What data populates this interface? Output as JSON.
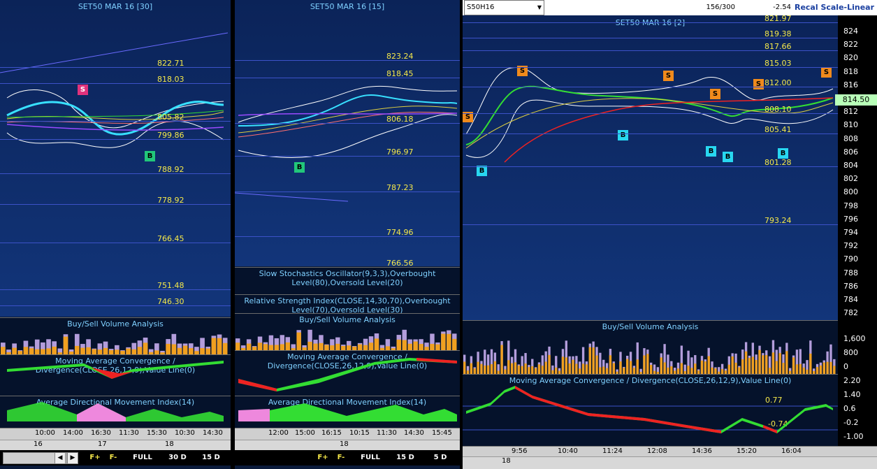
{
  "left": {
    "title": "SET50 MAR 16  [30]",
    "levels": [
      "822.71",
      "818.03",
      "805.82",
      "799.86",
      "788.92",
      "778.92",
      "766.45",
      "751.48",
      "746.30"
    ],
    "sub_vol": "Buy/Sell Volume Analysis",
    "sub_macd": "Moving Average Convergence / Divergence(CLOSE,26,12,9),Value Line(0)",
    "sub_adx": "Average Directional Movement Index(14)",
    "times": [
      "10:00",
      "14:00",
      "16:30",
      "11:30",
      "15:30",
      "10:30",
      "14:30"
    ],
    "dates": [
      "16",
      "17",
      "18"
    ],
    "signals": {
      "s": "S",
      "b": "B"
    },
    "toolbar": {
      "f_plus": "F+",
      "f_minus": "F-",
      "full": "FULL",
      "d30": "30 D",
      "d15": "15 D"
    }
  },
  "mid": {
    "title": "SET50 MAR 16  [15]",
    "levels": [
      "823.24",
      "818.45",
      "806.18",
      "796.97",
      "787.23",
      "774.96",
      "766.56"
    ],
    "sub_stoch": "Slow Stochastics Oscillator(9,3,3),Overbought Level(80),Oversold Level(20)",
    "sub_rsi": "Relative Strength Index(CLOSE,14,30,70),Overbought Level(70),Oversold Level(30)",
    "sub_vol": "Buy/Sell Volume Analysis",
    "sub_macd": "Moving Average Convergence / Divergence(CLOSE,26,12,9),Value Line(0)",
    "sub_adx": "Average Directional Movement Index(14)",
    "times": [
      "12:00",
      "15:00",
      "16:15",
      "10:15",
      "11:30",
      "14:30",
      "15:45"
    ],
    "dates": [
      "18"
    ],
    "signals": {
      "b": "B"
    },
    "toolbar": {
      "f_plus": "F+",
      "f_minus": "F-",
      "full": "FULL",
      "d15": "15 D",
      "d5": "5 D"
    }
  },
  "right": {
    "symbol": "S50H16",
    "count": "156/300",
    "change": "-2.54",
    "recal": "Recal Scale-Linear",
    "title": "SET50 MAR 16  [2]",
    "levels": [
      "821.97",
      "819.38",
      "817.66",
      "815.03",
      "812.00",
      "808.10",
      "805.41",
      "801.28",
      "793.24"
    ],
    "last_price": "814.50",
    "scale": [
      "824",
      "822",
      "820",
      "818",
      "816",
      "814",
      "812",
      "810",
      "808",
      "806",
      "804",
      "802",
      "800",
      "798",
      "796",
      "794",
      "792",
      "790",
      "788",
      "786",
      "784",
      "782"
    ],
    "vol_scale": [
      "1,600",
      "800",
      "0"
    ],
    "macd_scale": [
      "2.20",
      "1.40",
      "0.6",
      "-0.2",
      "-1.00"
    ],
    "macd_vals": [
      "0.77",
      "-0.74"
    ],
    "sub_vol": "Buy/Sell Volume Analysis",
    "sub_macd": "Moving Average Convergence / Divergence(CLOSE,26,12,9),Value Line(0)",
    "times": [
      "9:56",
      "10:40",
      "11:24",
      "12:08",
      "14:36",
      "15:20",
      "16:04"
    ],
    "dates": [
      "18"
    ],
    "signals": {
      "s": "S",
      "b": "B"
    }
  },
  "colors": {
    "bg": "#0b2358",
    "level": "#3c52c8",
    "label": "#f5e84a",
    "title": "#7fd0ff",
    "vol_buy": "#f0a020",
    "vol_sell": "#b39ddb",
    "up": "#33dd33",
    "down": "#ee2222"
  }
}
